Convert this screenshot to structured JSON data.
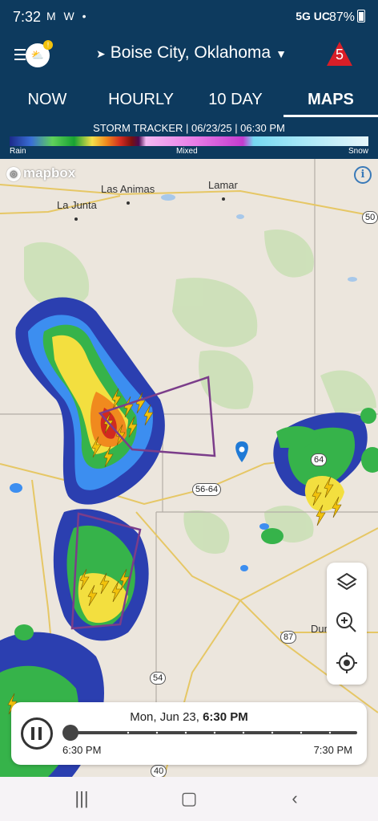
{
  "status_bar": {
    "time": "7:32",
    "left_icons": "M W •",
    "network": "5G UC",
    "battery": "87%"
  },
  "header": {
    "location": "Boise City, Oklahoma",
    "alert_count": "5"
  },
  "tabs": [
    {
      "label": "NOW",
      "active": false
    },
    {
      "label": "HOURLY",
      "active": false
    },
    {
      "label": "10 DAY",
      "active": false
    },
    {
      "label": "MAPS",
      "active": true
    }
  ],
  "legend": {
    "title": "STORM TRACKER | 06/23/25 | 06:30 PM",
    "rain_label": "Rain",
    "mixed_label": "Mixed",
    "snow_label": "Snow"
  },
  "map": {
    "attribution": "mapbox",
    "towns": [
      "Las Animas",
      "Lamar",
      "La Junta",
      "Dum"
    ],
    "route_shields": [
      "50",
      "64",
      "56-64",
      "87",
      "54",
      "40"
    ]
  },
  "playback": {
    "date_prefix": "Mon, Jun 23,",
    "date_time": "6:30 PM",
    "start_time": "6:30 PM",
    "end_time": "7:30 PM",
    "progress": 0.0
  }
}
